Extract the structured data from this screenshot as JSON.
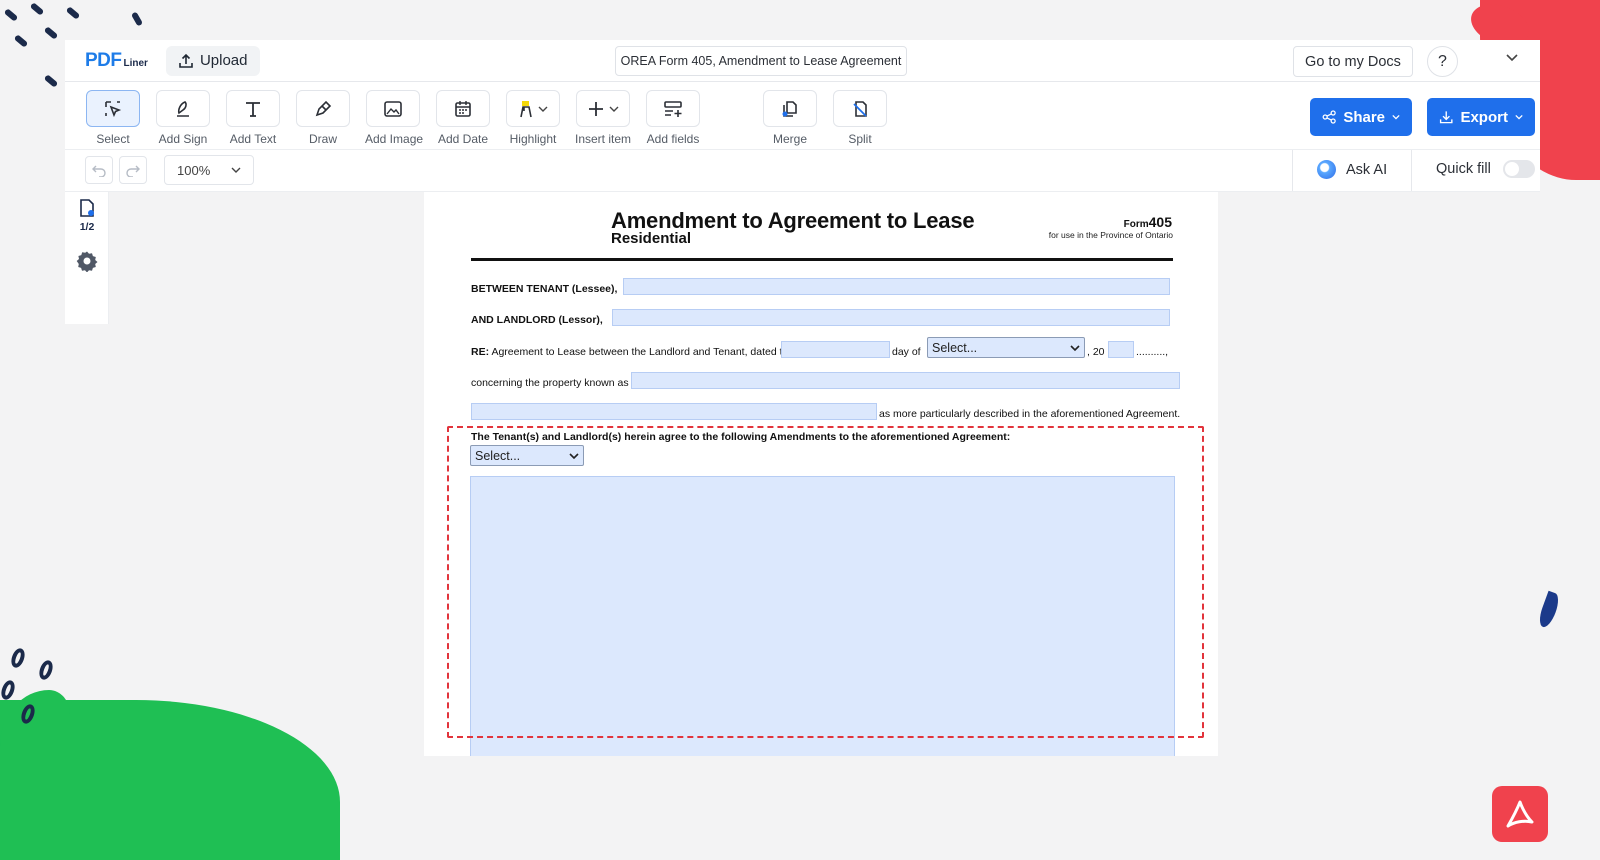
{
  "app": {
    "logo_main": "PDF",
    "logo_sub": "Liner",
    "upload_label": "Upload",
    "doc_title": "OREA Form 405, Amendment to Lease Agreement",
    "goto_docs_label": "Go to my Docs",
    "help_label": "?"
  },
  "toolbar": {
    "tools": [
      {
        "label": "Select",
        "icon": "select-cursor-icon"
      },
      {
        "label": "Add Sign",
        "icon": "sign-pen-icon"
      },
      {
        "label": "Add Text",
        "icon": "text-icon"
      },
      {
        "label": "Draw",
        "icon": "draw-pen-icon"
      },
      {
        "label": "Add Image",
        "icon": "image-icon"
      },
      {
        "label": "Add Date",
        "icon": "calendar-icon"
      },
      {
        "label": "Highlight",
        "icon": "highlighter-icon"
      },
      {
        "label": "Insert item",
        "icon": "plus-icon"
      },
      {
        "label": "Add fields",
        "icon": "add-fields-icon"
      },
      {
        "label": "Merge",
        "icon": "merge-icon"
      },
      {
        "label": "Split",
        "icon": "split-icon"
      }
    ],
    "share_label": "Share",
    "export_label": "Export"
  },
  "subbar": {
    "zoom": "100%",
    "ask_ai_label": "Ask AI",
    "quick_fill_label": "Quick fill",
    "quick_fill_on": false
  },
  "sidebar": {
    "page_indicator": "1/2"
  },
  "document": {
    "title": "Amendment to Agreement to Lease",
    "subtitle": "Residential",
    "form_prefix": "Form",
    "form_number": "405",
    "province_note": "for use in the Province of Ontario",
    "tenant_label": "BETWEEN TENANT (Lessee),",
    "landlord_label": "AND LANDLORD (Lessor),",
    "re_bold": "RE:",
    "re_text": "Agreement to Lease between the Landlord and Tenant, dated the",
    "day_of": "day of",
    "month_select": "Select...",
    "year_prefix": ", 20",
    "year_suffix": "..........,",
    "property_label": "concerning the property known as",
    "described_label": "as more particularly described in the aforementioned Agreement.",
    "amendments_heading": "The Tenant(s) and Landlord(s) herein agree to the following Amendments to the aforementioned Agreement:",
    "amendment_select": "Select..."
  },
  "colors": {
    "accent": "#1f6feb",
    "field_fill": "#dce8fd",
    "highlight_border": "#e2343c"
  }
}
